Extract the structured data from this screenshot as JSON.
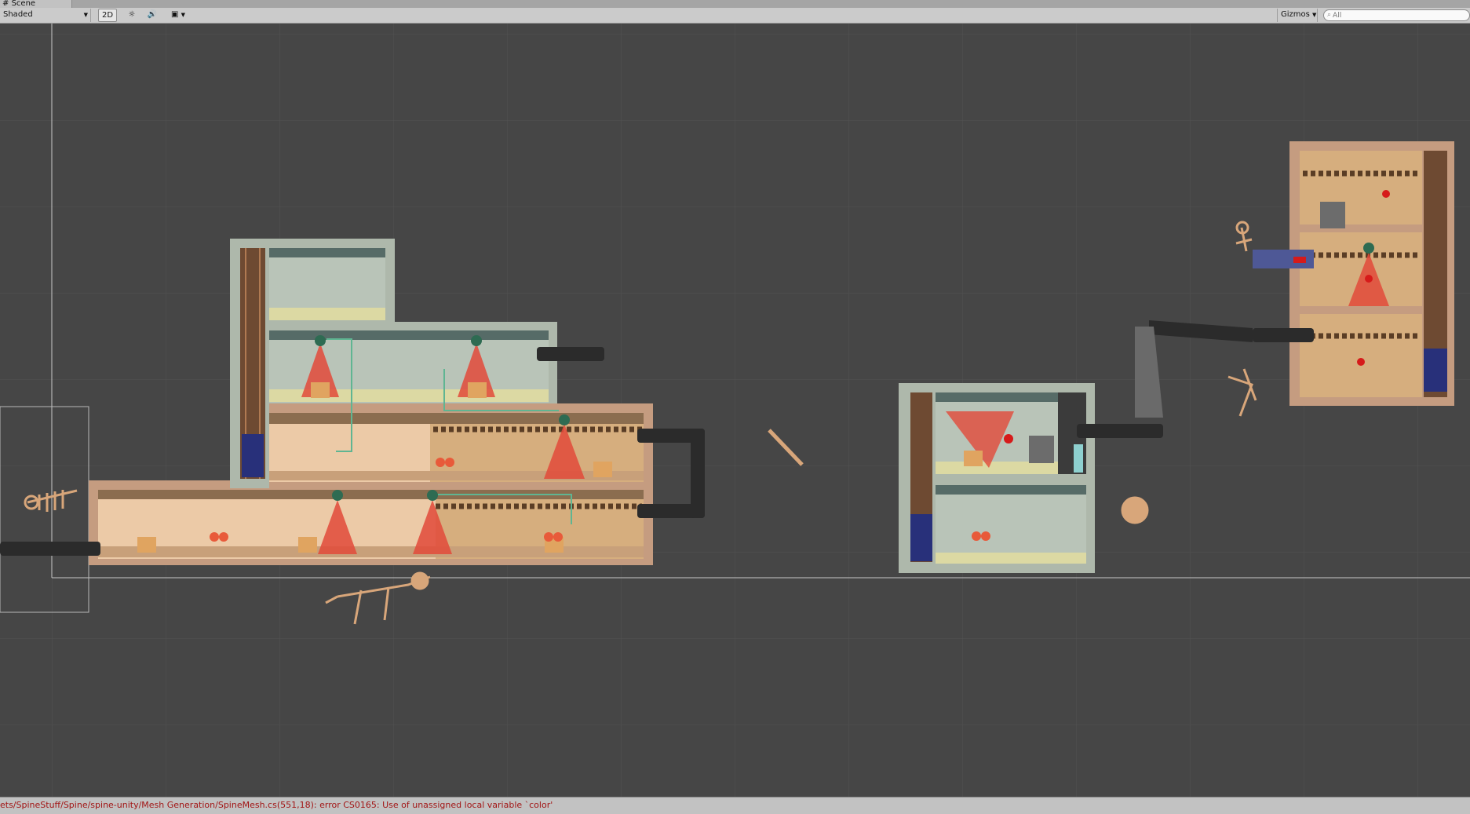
{
  "window": {
    "tab_title": "Scene",
    "tab_icon": "scene-icon"
  },
  "toolbar": {
    "shading_mode": "Shaded",
    "mode_2d": "2D",
    "lighting_icon": "sun-icon",
    "audio_icon": "speaker-icon",
    "effects_icon": "image-icon",
    "gizmos_label": "Gizmos",
    "search_placeholder": "All",
    "search_icon": "search-icon"
  },
  "status": {
    "message": "ets/SpineStuff/Spine/spine-unity/Mesh Generation/SpineMesh.cs(551,18): error CS0165: Use of unassigned local variable `color'"
  },
  "colors": {
    "viewport_bg": "#464646",
    "room_tan": "#e8c9a4",
    "room_teal": "#b7c1b4",
    "frame": "#c79c7d",
    "camera_cone": "#e24a3a",
    "error_text": "#a21515"
  }
}
